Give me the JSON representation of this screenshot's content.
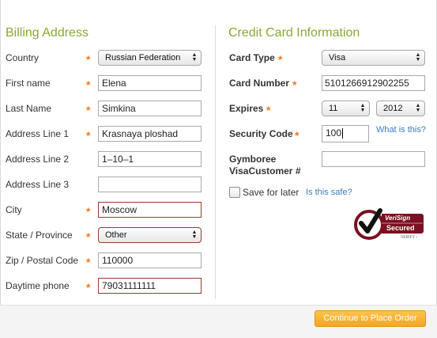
{
  "billing": {
    "title": "Billing Address",
    "fields": {
      "country": {
        "label": "Country",
        "required": "*",
        "value": "Russian Federation"
      },
      "first_name": {
        "label": "First name",
        "required": "*",
        "value": "Elena"
      },
      "last_name": {
        "label": "Last Name",
        "required": "*",
        "value": "Simkina"
      },
      "address1": {
        "label": "Address Line 1",
        "required": "*",
        "value": "Krasnaya ploshad"
      },
      "address2": {
        "label": "Address Line 2",
        "value": "1–10–1"
      },
      "address3": {
        "label": "Address Line 3",
        "value": ""
      },
      "city": {
        "label": "City",
        "required": "*",
        "value": "Moscow"
      },
      "state": {
        "label": "State / Province",
        "required": "*",
        "value": "Other"
      },
      "zip": {
        "label": "Zip / Postal Code",
        "required": "*",
        "value": "110000"
      },
      "phone": {
        "label": "Daytime phone",
        "required": "*",
        "value": "79031111111"
      }
    }
  },
  "card": {
    "title": "Credit Card Information",
    "type": {
      "label": "Card Type",
      "required": "*",
      "value": "Visa"
    },
    "number": {
      "label": "Card Number",
      "required": "*",
      "value": "5101266912902255"
    },
    "expires": {
      "label": "Expires",
      "required": "*",
      "month": "11",
      "year": "2012"
    },
    "security": {
      "label": "Security Code",
      "required": "*",
      "value": "100",
      "help_link": "What is this?"
    },
    "gymboree": {
      "label_line1": "Gymboree",
      "label_line2": "VisaCustomer #",
      "value": ""
    },
    "save": {
      "label": "Save for later",
      "checked": false,
      "help_link": "Is this safe?"
    },
    "seal": {
      "line1": "VeriSign",
      "line2": "Secured",
      "line3": "VERIFY ›"
    }
  },
  "footer": {
    "continue_label": "Continue to Place Order"
  },
  "colors": {
    "accent_green": "#8aa832",
    "required_orange": "#f07a24",
    "cta_orange": "#f5a623",
    "link_blue": "#3a7cc0",
    "error_border": "#9a3a2a"
  }
}
